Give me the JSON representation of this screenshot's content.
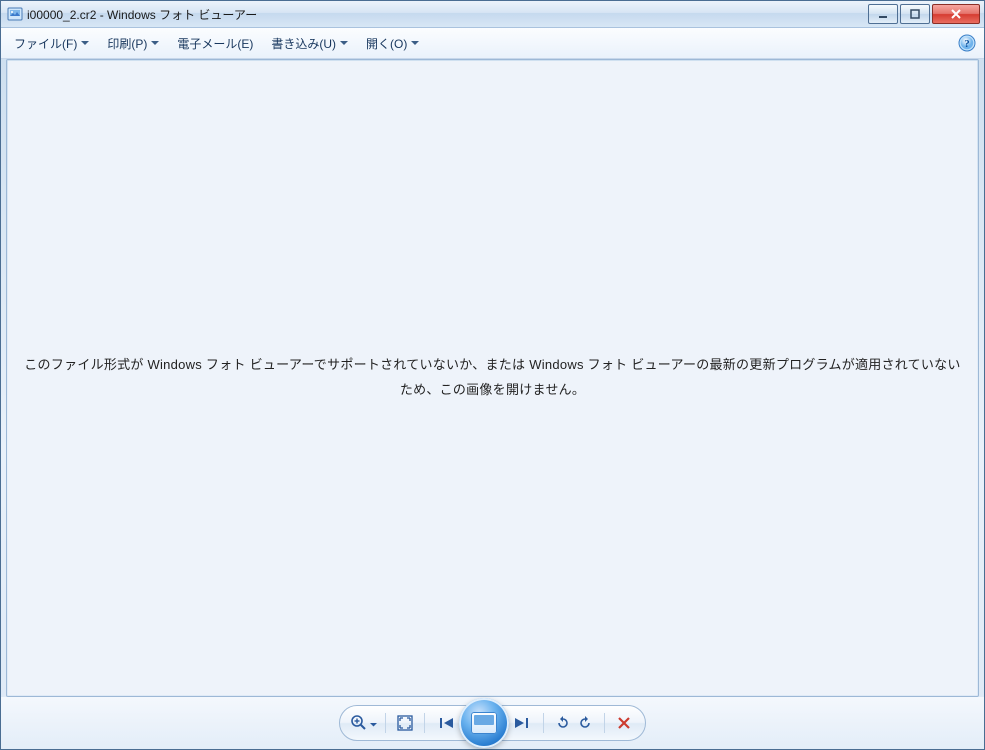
{
  "title": "i00000_2.cr2 - Windows フォト ビューアー",
  "menu": {
    "file": "ファイル(F)",
    "print": "印刷(P)",
    "email": "電子メール(E)",
    "burn": "書き込み(U)",
    "open": "開く(O)"
  },
  "error_message": "このファイル形式が Windows フォト ビューアーでサポートされていないか、または Windows フォト ビューアーの最新の更新プログラムが適用されていないため、この画像を開けません。",
  "icons": {
    "help": "help-icon",
    "minimize": "minimize-icon",
    "maximize": "maximize-icon",
    "close": "close-icon",
    "zoom": "magnifier-icon",
    "fit": "fit-to-window-icon",
    "prev": "previous-icon",
    "slideshow": "slideshow-icon",
    "next": "next-icon",
    "rotate_ccw": "rotate-ccw-icon",
    "rotate_cw": "rotate-cw-icon",
    "delete": "delete-icon"
  }
}
